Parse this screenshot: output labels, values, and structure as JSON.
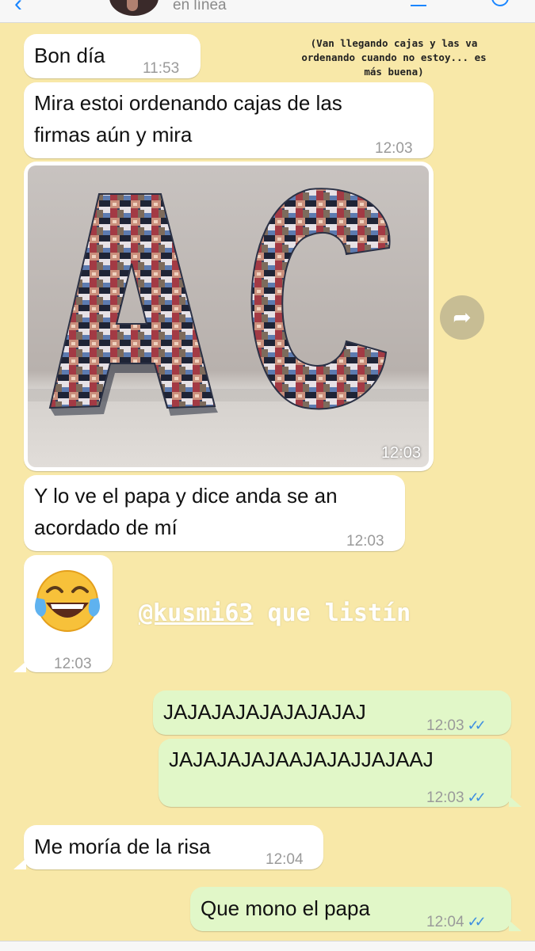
{
  "header": {
    "status": "en línea",
    "back_glyph": "‹"
  },
  "caption": "(Van llegando cajas y las va ordenando cuando no estoy... es más buena)",
  "messages": [
    {
      "direction": "in",
      "text": "Bon día",
      "time": "11:53"
    },
    {
      "direction": "in",
      "text_lines": [
        "Mira estoi ordenando cajas de las",
        "firmas aún y mira"
      ],
      "time": "12:03"
    },
    {
      "direction": "in",
      "type": "image",
      "image_description": "Cardboard letters A and C decorated with photo collage",
      "time": "12:03"
    },
    {
      "direction": "in",
      "text_lines": [
        "Y lo ve el papa y dice anda se an",
        "acordado de mí"
      ],
      "time": "12:03"
    },
    {
      "direction": "in",
      "type": "emoji",
      "emoji": "😂",
      "time": "12:03"
    },
    {
      "direction": "out",
      "text": "JAJAJAJAJAJAJAJAJ",
      "time": "12:03",
      "ticks": "✓✓"
    },
    {
      "direction": "out",
      "text": "JAJAJAJAJAAJAJAJJAJAAJ",
      "time": "12:03",
      "ticks": "✓✓"
    },
    {
      "direction": "in",
      "text": "Me moría de la risa",
      "time": "12:04"
    },
    {
      "direction": "out",
      "text": "Que mono el papa",
      "time": "12:04",
      "ticks": "✓✓"
    }
  ],
  "mention": {
    "user": "@kusmi63",
    "text": "que listín"
  },
  "forward_icon": "forward-arrow-icon",
  "colors": {
    "chat_background": "#f8e8a8",
    "incoming_bubble": "#ffffff",
    "outgoing_bubble": "#e1f7c8",
    "read_ticks": "#3f8fe0",
    "ios_blue": "#1a86ff"
  }
}
